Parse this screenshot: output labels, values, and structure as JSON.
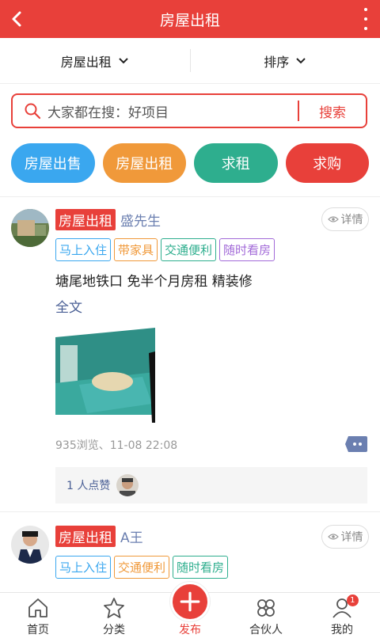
{
  "header": {
    "title": "房屋出租"
  },
  "filters": {
    "category": "房屋出租",
    "sort": "排序"
  },
  "search": {
    "placeholder": "大家都在搜：好项目",
    "button": "搜索"
  },
  "categories": [
    {
      "label": "房屋出售",
      "color": "#3aa7ef"
    },
    {
      "label": "房屋出租",
      "color": "#f0993a"
    },
    {
      "label": "求租",
      "color": "#2eae8e"
    },
    {
      "label": "求购",
      "color": "#e8403a"
    }
  ],
  "posts": [
    {
      "category": "房屋出租",
      "user": "盛先生",
      "detail": "详情",
      "features": [
        {
          "label": "马上入住",
          "color": "#3aa7ef"
        },
        {
          "label": "带家具",
          "color": "#f0993a"
        },
        {
          "label": "交通便利",
          "color": "#2eae8e"
        },
        {
          "label": "随时看房",
          "color": "#a26ad8"
        }
      ],
      "description": "塘尾地铁口 免半个月房租 精装修",
      "fulltext": "全文",
      "meta": "935浏览、11-08 22:08",
      "likes": "1 人点赞"
    },
    {
      "category": "房屋出租",
      "user": "A王",
      "detail": "详情",
      "features": [
        {
          "label": "马上入住",
          "color": "#3aa7ef"
        },
        {
          "label": "交通便利",
          "color": "#f0993a"
        },
        {
          "label": "随时看房",
          "color": "#2eae8e"
        }
      ]
    }
  ],
  "bottom_nav": [
    {
      "label": "首页",
      "icon": "home-icon"
    },
    {
      "label": "分类",
      "icon": "star-icon"
    },
    {
      "label": "发布",
      "icon": "plus-icon"
    },
    {
      "label": "合伙人",
      "icon": "clover-icon"
    },
    {
      "label": "我的",
      "icon": "person-icon",
      "badge": "1"
    }
  ]
}
